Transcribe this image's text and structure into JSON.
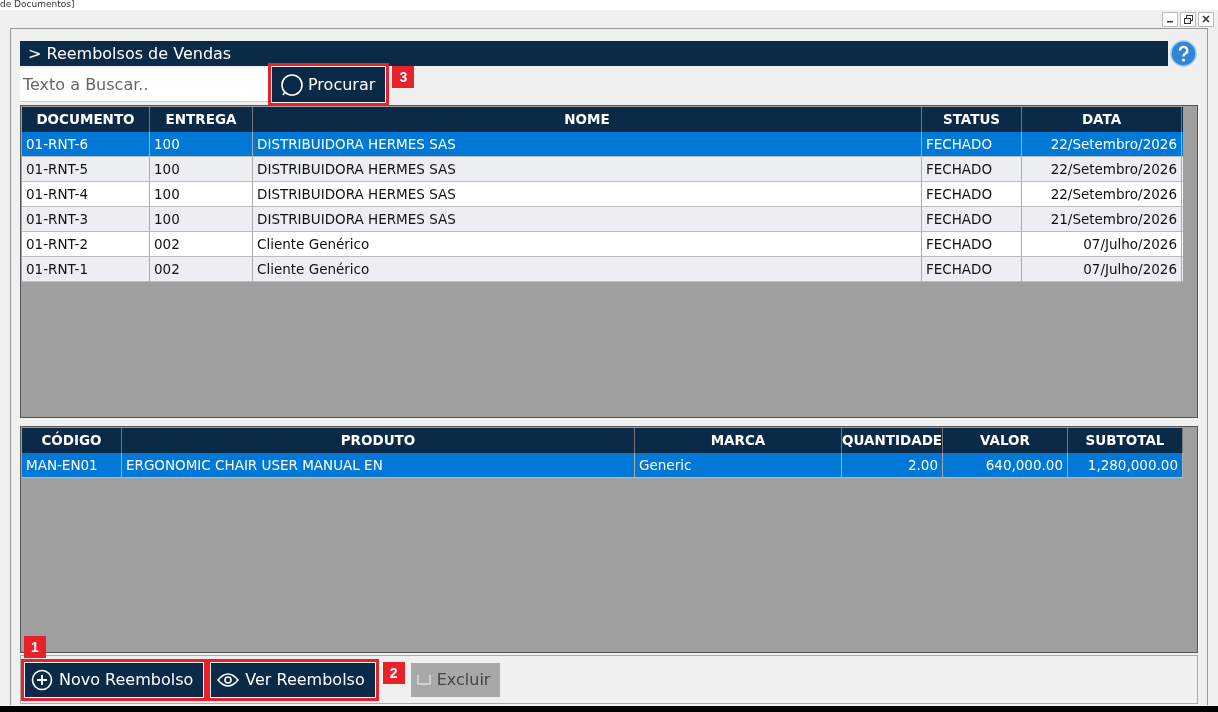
{
  "window": {
    "title": "de Documentos]"
  },
  "header": {
    "title": "> Reembolsos de Vendas"
  },
  "search": {
    "placeholder": "Texto a Buscar..",
    "button": "Procurar",
    "callout": "3"
  },
  "documents": {
    "columns": [
      {
        "label": "DOCUMENTO"
      },
      {
        "label": "ENTREGA"
      },
      {
        "label": "NOME"
      },
      {
        "label": "STATUS"
      },
      {
        "label": "DATA"
      }
    ],
    "rows": [
      {
        "selected": true,
        "cells": [
          "01-RNT-6",
          "100",
          "DISTRIBUIDORA HERMES SAS",
          "FECHADO",
          "22/Setembro/2026"
        ]
      },
      {
        "selected": false,
        "cells": [
          "01-RNT-5",
          "100",
          "DISTRIBUIDORA HERMES SAS",
          "FECHADO",
          "22/Setembro/2026"
        ]
      },
      {
        "selected": false,
        "cells": [
          "01-RNT-4",
          "100",
          "DISTRIBUIDORA HERMES SAS",
          "FECHADO",
          "22/Setembro/2026"
        ]
      },
      {
        "selected": false,
        "cells": [
          "01-RNT-3",
          "100",
          "DISTRIBUIDORA HERMES SAS",
          "FECHADO",
          "21/Setembro/2026"
        ]
      },
      {
        "selected": false,
        "cells": [
          "01-RNT-2",
          "002",
          "Cliente Genérico",
          "FECHADO",
          "07/Julho/2026"
        ]
      },
      {
        "selected": false,
        "cells": [
          "01-RNT-1",
          "002",
          "Cliente Genérico",
          "FECHADO",
          "07/Julho/2026"
        ]
      }
    ]
  },
  "items": {
    "columns": [
      {
        "label": "CÓDIGO"
      },
      {
        "label": "PRODUTO"
      },
      {
        "label": "MARCA"
      },
      {
        "label": "QUANTIDADE"
      },
      {
        "label": "VALOR"
      },
      {
        "label": "SUBTOTAL"
      }
    ],
    "rows": [
      {
        "selected": true,
        "cells": [
          "MAN-EN01",
          "ERGONOMIC CHAIR USER MANUAL EN",
          "Generic",
          "2.00",
          "640,000.00",
          "1,280,000.00"
        ]
      }
    ]
  },
  "actions": [
    {
      "kind": "add",
      "label": "Novo Reembolso",
      "disabled": false,
      "callout": "1"
    },
    {
      "kind": "view",
      "label": "Ver Reembolso",
      "disabled": false,
      "callout": "2"
    },
    {
      "kind": "delete",
      "label": "Excluir",
      "disabled": true
    }
  ]
}
